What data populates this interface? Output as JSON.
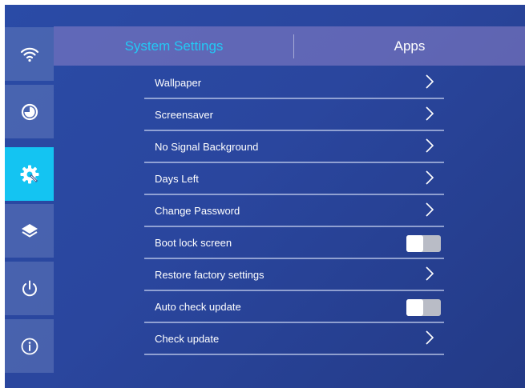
{
  "tabs": {
    "system_settings": "System Settings",
    "apps": "Apps"
  },
  "sidebar": {
    "items": [
      {
        "icon": "wifi-icon",
        "active": false
      },
      {
        "icon": "clock-icon",
        "active": false
      },
      {
        "icon": "gear-icon",
        "active": true
      },
      {
        "icon": "layers-icon",
        "active": false
      },
      {
        "icon": "power-icon",
        "active": false
      },
      {
        "icon": "info-icon",
        "active": false
      }
    ]
  },
  "settings": {
    "rows": [
      {
        "label": "Wallpaper",
        "control": "chevron"
      },
      {
        "label": "Screensaver",
        "control": "chevron"
      },
      {
        "label": "No Signal Background",
        "control": "chevron"
      },
      {
        "label": "Days Left",
        "control": "chevron"
      },
      {
        "label": "Change Password",
        "control": "chevron"
      },
      {
        "label": "Boot lock screen",
        "control": "toggle",
        "on": false
      },
      {
        "label": "Restore factory settings",
        "control": "chevron"
      },
      {
        "label": "Auto check update",
        "control": "toggle",
        "on": false
      },
      {
        "label": "Check update",
        "control": "chevron"
      }
    ]
  },
  "colors": {
    "accent": "#14c4f2",
    "active_tab_text": "#22c9f5",
    "background": "#2a469e"
  }
}
